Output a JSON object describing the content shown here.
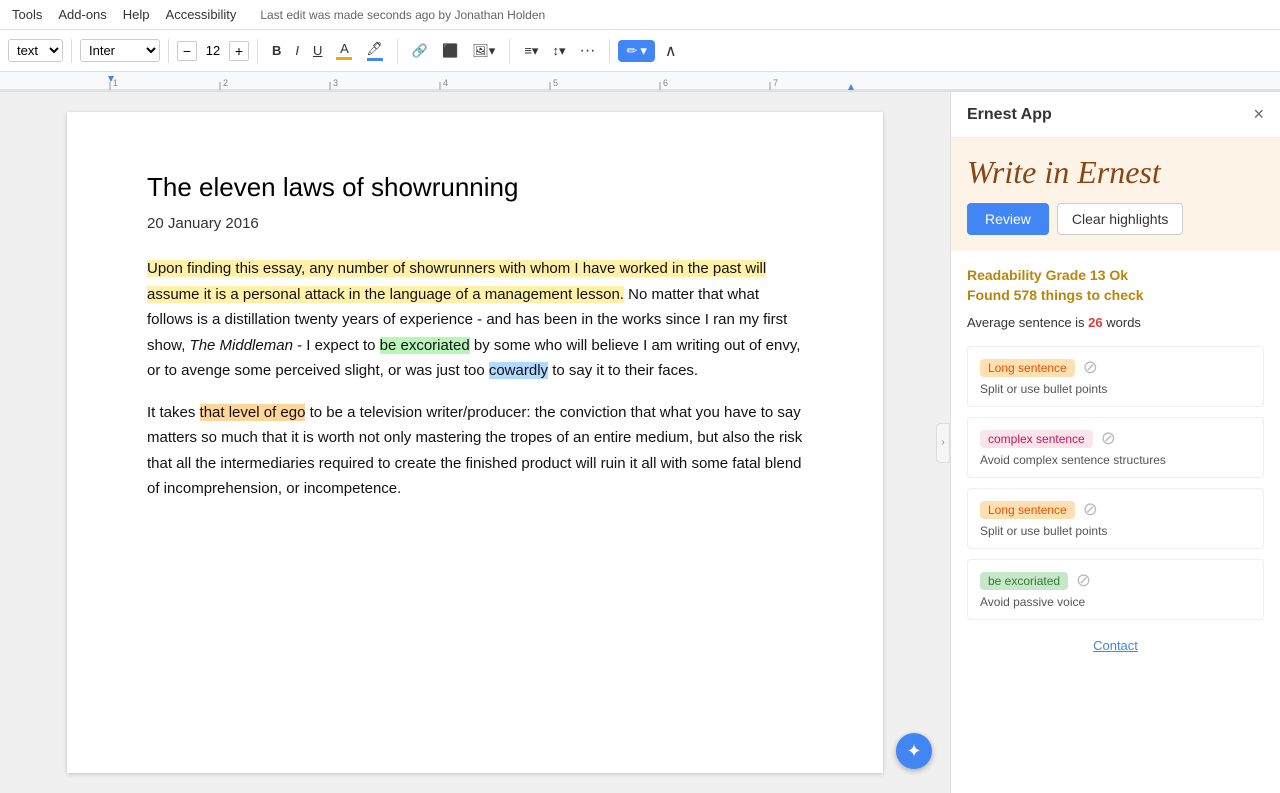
{
  "menubar": {
    "items": [
      "Tools",
      "Add-ons",
      "Help",
      "Accessibility"
    ],
    "last_edit": "Last edit was made seconds ago by Jonathan Holden"
  },
  "toolbar": {
    "style_label": "text",
    "font_label": "Inter",
    "font_size": "12",
    "bold_label": "B",
    "italic_label": "I",
    "underline_label": "U",
    "color_bar_color": "#f4a700",
    "highlight_color": "#4285f4",
    "decrease_icon": "−",
    "increase_icon": "+",
    "link_icon": "🔗",
    "image_icon": "🖼",
    "align_icon": "≡",
    "spacing_icon": "↕",
    "more_icon": "···",
    "pen_icon": "✏",
    "collapse_icon": "∧"
  },
  "document": {
    "title": "The eleven laws of showrunning",
    "date": "20 January 2016",
    "paragraph1": {
      "segments": [
        {
          "text": "Upon finding this essay, any number of showrunners with whom I have worked in the past will assume it is a personal attack in the language of a management lesson.",
          "highlight": "yellow"
        },
        {
          "text": " No matter that what follows is a distillation twenty years of experience - and has been in the works since I ran my first show, ",
          "highlight": "none"
        },
        {
          "text": "The Middleman",
          "highlight": "none",
          "italic": true
        },
        {
          "text": " - I expect to ",
          "highlight": "none"
        },
        {
          "text": "be excoriated",
          "highlight": "green"
        },
        {
          "text": " by some who will believe I am writing out of envy, or to avenge some perceived slight, or was just too ",
          "highlight": "none"
        },
        {
          "text": "cowardly",
          "highlight": "blue"
        },
        {
          "text": " to say it to their faces.",
          "highlight": "none"
        }
      ]
    },
    "paragraph2": {
      "pre": "It takes ",
      "highlight_segment": "that level of ego",
      "highlight": "orange",
      "post": " to be a television writer/producer: the conviction that what you have to say matters so much that it is worth not only mastering the tropes of an entire medium, but also the risk that all the intermediaries required to create the finished product will ruin it all with some fatal blend of incomprehension, or incompetence."
    }
  },
  "panel": {
    "title": "Ernest App",
    "close_icon": "×",
    "logo_text": "Write in Ernest",
    "review_label": "Review",
    "clear_highlights_label": "Clear highlights",
    "readability": "Readability Grade 13 Ok",
    "found_issues": "Found 578 things to check",
    "avg_sentence_prefix": "Average sentence is ",
    "avg_sentence_count": "26",
    "avg_sentence_suffix": " words",
    "issues": [
      {
        "tag": "Long sentence",
        "tag_class": "tag-orange",
        "desc": "Split or use bullet points",
        "icon": "⊘"
      },
      {
        "tag": "complex sentence",
        "tag_class": "tag-pink",
        "desc": "Avoid complex sentence structures",
        "icon": "⊘"
      },
      {
        "tag": "Long sentence",
        "tag_class": "tag-orange",
        "desc": "Split or use bullet points",
        "icon": "⊘"
      },
      {
        "tag": "be excoriated",
        "tag_class": "tag-green",
        "desc": "Avoid passive voice",
        "icon": "⊘"
      }
    ],
    "contact_label": "Contact"
  }
}
